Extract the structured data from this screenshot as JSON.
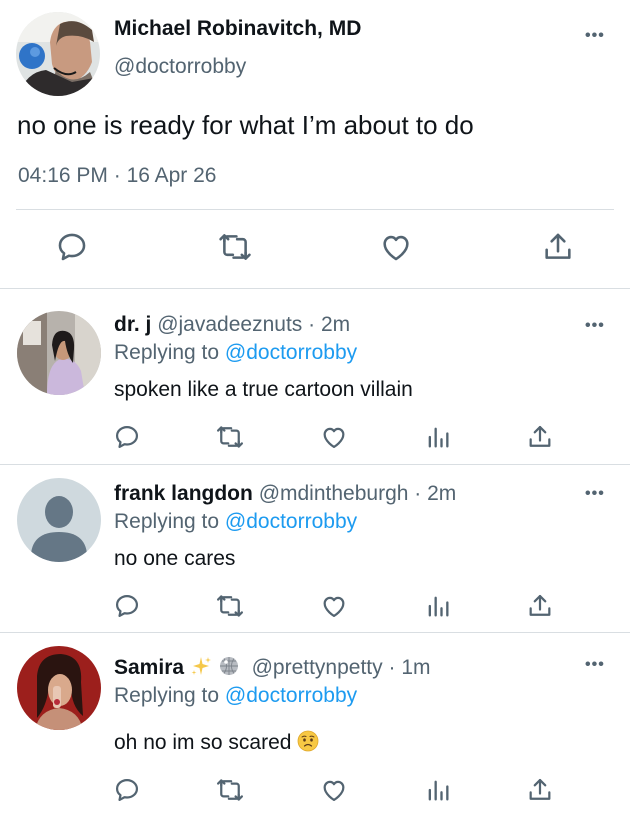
{
  "main_tweet": {
    "author_name": "Michael Robinavitch, MD",
    "author_handle": "@doctorrobby",
    "text": "no one is ready for what I’m about to do",
    "time": "04:16 PM",
    "separator": "·",
    "date": "16 Apr 26",
    "more_label": "•••"
  },
  "replies": [
    {
      "name": "dr. j",
      "handle": "@javadeeznuts",
      "separator": "·",
      "age": "2m",
      "replying_prefix": "Replying to ",
      "replying_mention": "@doctorrobby",
      "text": "spoken like a true cartoon villain",
      "more_label": "•••"
    },
    {
      "name": "frank langdon",
      "handle": "@mdintheburgh",
      "separator": "·",
      "age": "2m",
      "replying_prefix": "Replying to ",
      "replying_mention": "@doctorrobby",
      "text": "no one cares",
      "more_label": "•••"
    },
    {
      "name": "Samira",
      "name_decorations": [
        "sparkles-emoji",
        "disco-ball-emoji"
      ],
      "handle": "@prettynpetty",
      "separator": "·",
      "age": "1m",
      "replying_prefix": "Replying to ",
      "replying_mention": "@doctorrobby",
      "text": "oh no im so scared",
      "text_emoji": "worried-face-emoji",
      "more_label": "•••"
    }
  ],
  "colors": {
    "text": "#0f1419",
    "secondary": "#536471",
    "link": "#1d9bf0",
    "divider": "#d9dee2"
  }
}
